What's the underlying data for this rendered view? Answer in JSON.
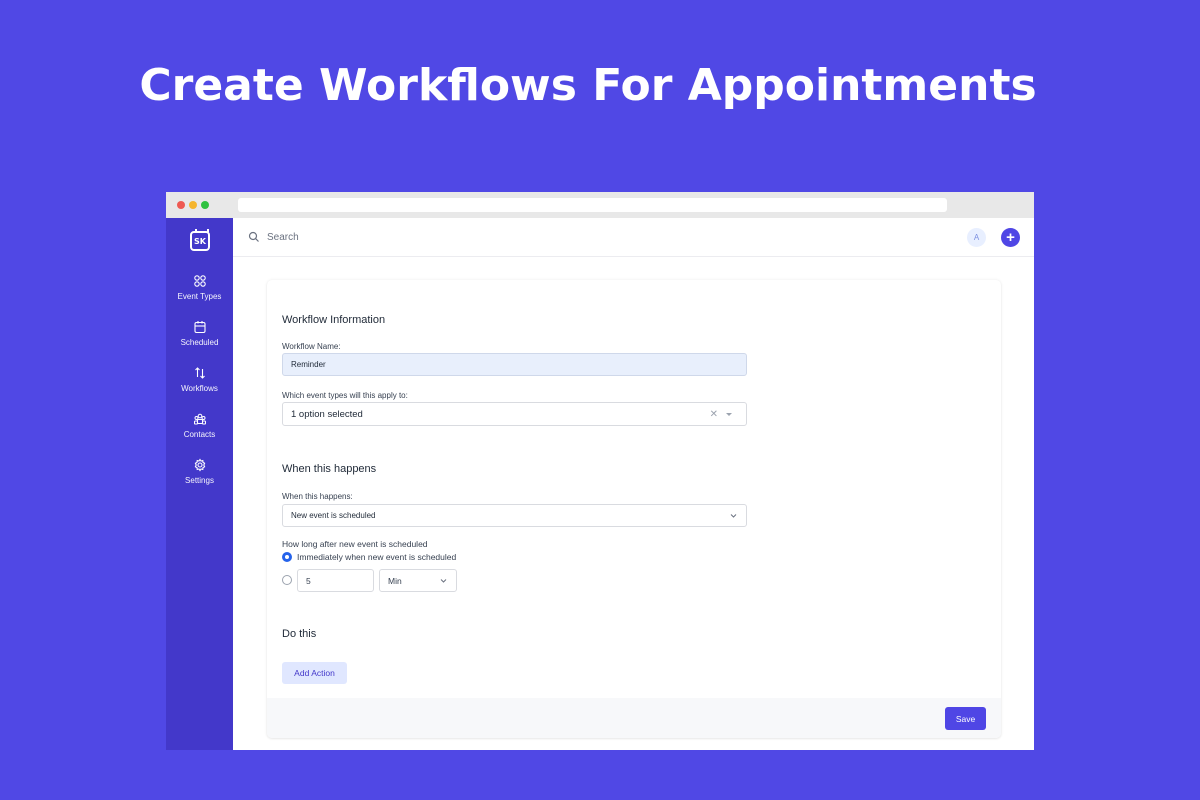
{
  "hero": {
    "title": "Create Workflows For Appointments"
  },
  "colors": {
    "background": "#5048e5",
    "sidebar": "#4338ca",
    "accent": "#4f46e5"
  },
  "app": {
    "logo_text": "SK"
  },
  "sidebar": {
    "items": [
      {
        "label": "Event Types",
        "icon": "grid-icon"
      },
      {
        "label": "Scheduled",
        "icon": "calendar-icon"
      },
      {
        "label": "Workflows",
        "icon": "arrows-up-down-icon"
      },
      {
        "label": "Contacts",
        "icon": "users-icon"
      },
      {
        "label": "Settings",
        "icon": "gear-icon"
      }
    ]
  },
  "topbar": {
    "search_placeholder": "Search",
    "avatar_initial": "A",
    "add_label": "+"
  },
  "form": {
    "section1_title": "Workflow Information",
    "workflow_name_label": "Workflow Name:",
    "workflow_name_value": "Reminder",
    "event_types_label": "Which event types will this apply to:",
    "event_types_value": "1 option selected",
    "section2_title": "When this happens",
    "trigger_label": "When this happens:",
    "trigger_value": "New event is scheduled",
    "timing_label": "How long after new event is scheduled",
    "timing_option_immediate": "Immediately when new event is scheduled",
    "timing_amount": "5",
    "timing_unit": "Min",
    "timing_selected": "immediate",
    "section3_title": "Do this",
    "add_action_label": "Add Action",
    "save_label": "Save"
  }
}
